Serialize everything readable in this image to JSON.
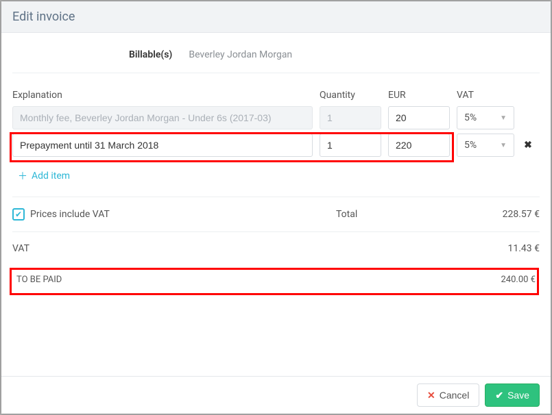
{
  "header": {
    "title": "Edit invoice"
  },
  "tabs": [
    {
      "label": "Billable(s)",
      "active": true
    },
    {
      "label": "Beverley Jordan Morgan",
      "active": false
    }
  ],
  "columns": {
    "explanation": "Explanation",
    "quantity": "Quantity",
    "eur": "EUR",
    "vat": "VAT"
  },
  "rows": [
    {
      "explanation": "Monthly fee, Beverley Jordan Morgan - Under 6s (2017-03)",
      "quantity": "1",
      "eur": "20",
      "vat": "5%",
      "disabled": true,
      "removable": false
    },
    {
      "explanation": "Prepayment until 31 March 2018",
      "quantity": "1",
      "eur": "220",
      "vat": "5%",
      "disabled": false,
      "removable": true
    }
  ],
  "add_item_label": "Add item",
  "summary": {
    "prices_include_vat_label": "Prices include VAT",
    "prices_include_vat_checked": true,
    "total_label": "Total",
    "total_value": "228.57 €",
    "vat_label": "VAT",
    "vat_value": "11.43 €",
    "to_be_paid_label": "TO BE PAID",
    "to_be_paid_value": "240.00 €"
  },
  "footer": {
    "cancel_label": "Cancel",
    "save_label": "Save"
  }
}
